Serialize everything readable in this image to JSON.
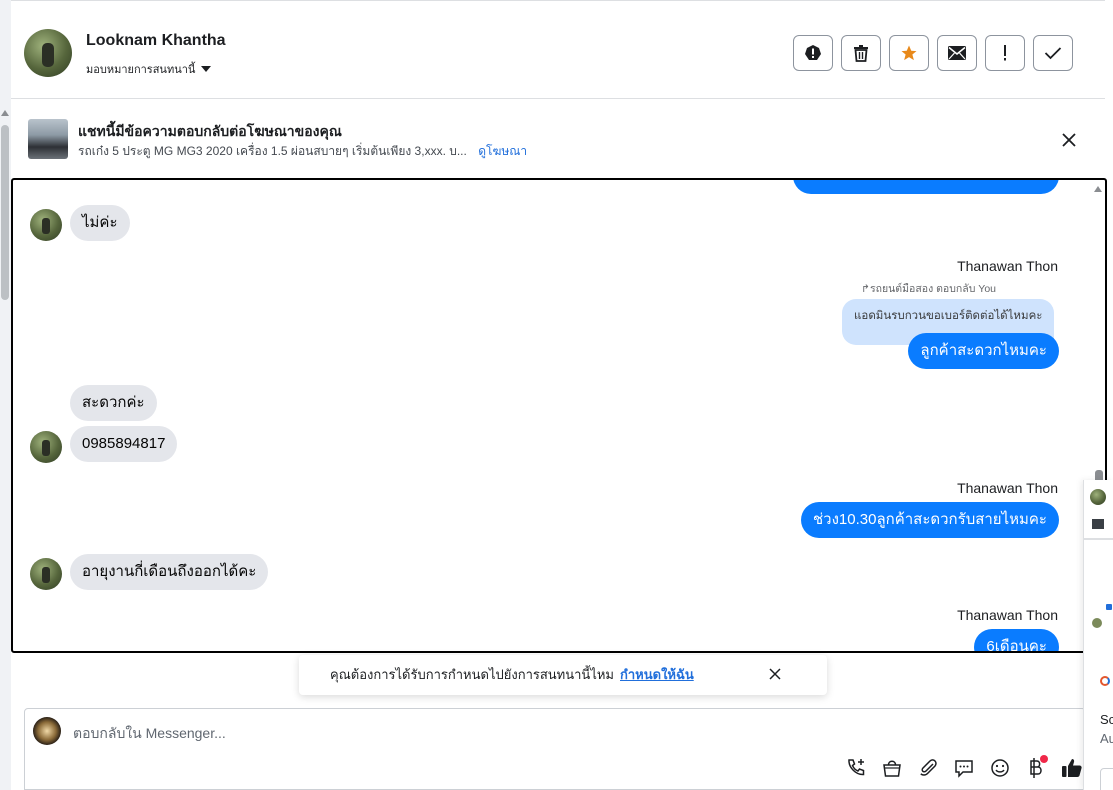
{
  "header": {
    "contact_name": "Looknam Khantha",
    "assign_label": "มอบหมายการสนทนานี้",
    "actions": [
      {
        "name": "report-icon",
        "label": "!"
      },
      {
        "name": "trash-icon",
        "label": ""
      },
      {
        "name": "star-icon",
        "label": ""
      },
      {
        "name": "envelope-icon",
        "label": ""
      },
      {
        "name": "exclamation-icon",
        "label": "!"
      },
      {
        "name": "check-icon",
        "label": ""
      }
    ],
    "star_color": "#e8891a"
  },
  "ad_banner": {
    "title": "แชทนี้มีข้อความตอบกลับต่อโฆษณาของคุณ",
    "description": "รถเก๋ง 5 ประตู MG MG3 2020 เครื่อง 1.5 ผ่อนสบายๆ เริ่มต้นเพียง 3,xxx. บ...",
    "link_label": "ดูโฆษณา"
  },
  "chat": {
    "messages": [
      {
        "direction": "in",
        "text": "ไม่ค่ะ"
      },
      {
        "direction": "out",
        "sender": "Thanawan Thon",
        "reply_meta": "รถยนต์มือสอง ตอบกลับ You",
        "quoted": "แอดมินรบกวนขอเบอร์ติดต่อได้ไหมคะ",
        "text": "ลูกค้าสะดวกไหมคะ"
      },
      {
        "direction": "in",
        "text": "สะดวกค่ะ"
      },
      {
        "direction": "in",
        "text": "0985894817"
      },
      {
        "direction": "out",
        "sender": "Thanawan Thon",
        "text": "ช่วง10.30ลูกค้าสะดวกรับสายไหมคะ"
      },
      {
        "direction": "in",
        "text": "อายุงานกี่เดือนถึงออกได้คะ"
      },
      {
        "direction": "out",
        "sender": "Thanawan Thon",
        "text": "6เดือนคะ"
      }
    ],
    "out_bubble_color": "#0a7cff",
    "in_bubble_color": "#e4e6eb"
  },
  "toast": {
    "text": "คุณต้องการได้รับการกำหนดไปยังการสนทนานี้ไหม",
    "link_label": "กำหนดให้ฉัน"
  },
  "composer": {
    "placeholder": "ตอบกลับใน Messenger...",
    "tools": [
      "phone-plus-icon",
      "shopping-bag-icon",
      "paperclip-icon",
      "chat-bubble-icon",
      "emoji-icon",
      "baht-icon",
      "thumbs-up-icon"
    ]
  },
  "right_panel": {
    "text1": "Sc",
    "text2": "Au"
  }
}
